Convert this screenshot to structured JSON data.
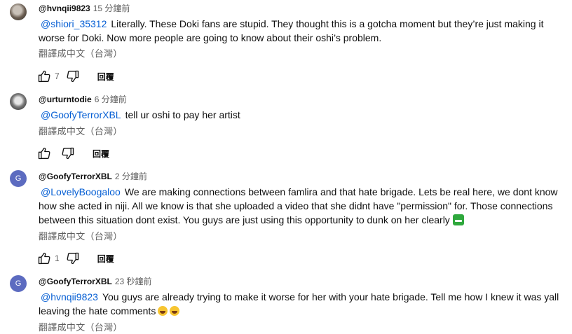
{
  "translate_label": "翻譯成中文（台灣）",
  "reply_label": "回覆",
  "comments": [
    {
      "author": "@hvnqii9823",
      "time": "15 分鐘前",
      "mention": "@shiori_35312",
      "text": "Literally. These Doki fans are stupid. They thought this is a gotcha moment but they’re just making it worse for Doki. Now more people are going to know about their oshi’s problem.",
      "likes": "7"
    },
    {
      "author": "@urturntodie",
      "time": "6 分鐘前",
      "mention": "@GoofyTerrorXBL",
      "text": "tell ur oshi to pay her artist",
      "likes": ""
    },
    {
      "author": "@GoofyTerrorXBL",
      "avatar_letter": "G",
      "time": "2 分鐘前",
      "mention": "@LovelyBoogaloo",
      "text": "We are making connections between famlira and that hate brigade. Lets be real here, we dont know how she acted in niji. All we know is that she uploaded a video that she didnt have \"permission\" for. Those connections between this situation dont exist. You guys are just using this opportunity to dunk on her clearly",
      "likes": "1"
    },
    {
      "author": "@GoofyTerrorXBL",
      "avatar_letter": "G",
      "time": "23 秒鐘前",
      "mention": "@hvnqii9823",
      "text": "You guys are already trying to make it worse for her with your hate brigade. Tell me how I knew it was yall leaving the hate comments"
    }
  ]
}
